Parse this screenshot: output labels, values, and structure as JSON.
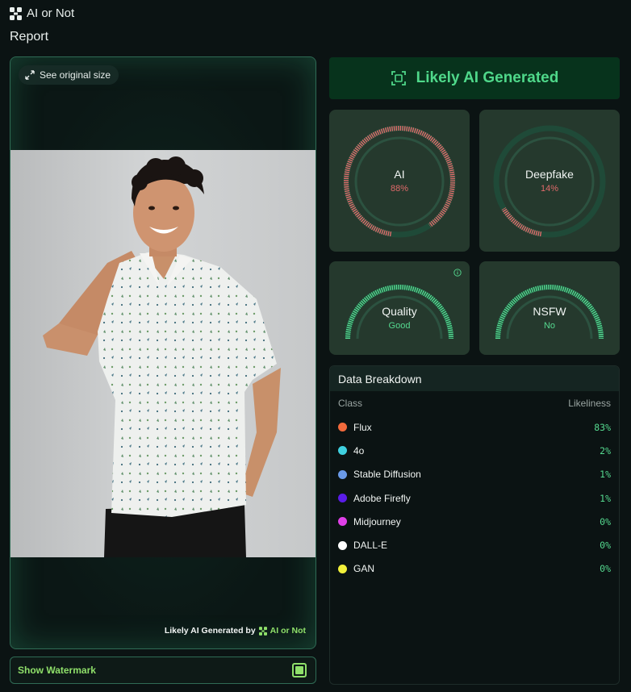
{
  "app": {
    "name": "AI or Not",
    "page_title": "Report"
  },
  "image_panel": {
    "see_original_label": "See original size",
    "watermark_prefix": "Likely AI Generated by",
    "watermark_brand": "AI or Not"
  },
  "watermark_toggle": {
    "label": "Show Watermark",
    "checked": true
  },
  "verdict": {
    "label": "Likely AI Generated",
    "color": "#4fd88a"
  },
  "gauges": {
    "ai": {
      "label": "AI",
      "value": "88%",
      "fraction": 0.88,
      "color": "#e06a6a"
    },
    "deepfake": {
      "label": "Deepfake",
      "value": "14%",
      "fraction": 0.14,
      "color": "#e06a6a"
    },
    "quality": {
      "label": "Quality",
      "value": "Good",
      "fraction": 1.0,
      "color": "#55d98f"
    },
    "nsfw": {
      "label": "NSFW",
      "value": "No",
      "fraction": 1.0,
      "color": "#55d98f"
    }
  },
  "breakdown": {
    "title": "Data Breakdown",
    "col_class": "Class",
    "col_likeliness": "Likeliness",
    "rows": [
      {
        "name": "Flux",
        "pct": "83%",
        "color": "#f26a3c"
      },
      {
        "name": "4o",
        "pct": "2%",
        "color": "#3fd0e0"
      },
      {
        "name": "Stable Diffusion",
        "pct": "1%",
        "color": "#6a9ae8"
      },
      {
        "name": "Adobe Firefly",
        "pct": "1%",
        "color": "#5a1ce8"
      },
      {
        "name": "Midjourney",
        "pct": "0%",
        "color": "#e040e8"
      },
      {
        "name": "DALL-E",
        "pct": "0%",
        "color": "#ffffff"
      },
      {
        "name": "GAN",
        "pct": "0%",
        "color": "#f2f03a"
      }
    ]
  }
}
